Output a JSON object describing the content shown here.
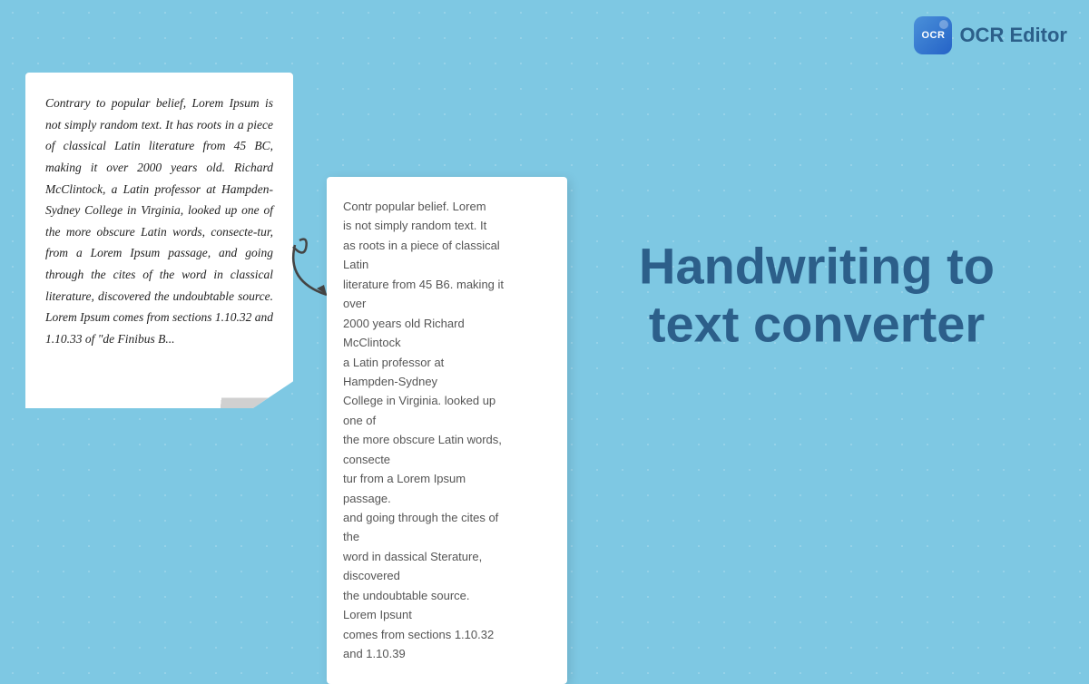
{
  "header": {
    "logo_text": "OCR",
    "title": "OCR Editor"
  },
  "handwritten": {
    "text": "Contrary to popular belief, Lorem Ipsum is not simply random text. It has roots in a piece of classical Latin literature from 45 BC, making it over 2000 years old. Richard McClintock, a Latin professor at Hampden-Sydney College in Virginia, looked up one of the more obscure Latin words, consecte-tur, from a Lorem Ipsum passage, and going through the cites of the word in classical literature, discovered the undoubtable source. Lorem Ipsum comes from sections 1.10.32 and 1.10.33 of \"de Finibus B..."
  },
  "ocr_output": {
    "lines": [
      "Contr popular belief. Lorem",
      "is not simply random text. It",
      "as roots in a piece of classical",
      "Latin",
      "literature from 45 B6. making it",
      "over",
      "2000 years old Richard",
      "McClintock",
      "a Latin professor at",
      "Hampden-Sydney",
      "College in Virginia. looked up",
      "one of",
      "the more obscure Latin words,",
      "consecte",
      "tur from a Lorem Ipsum",
      "passage.",
      "and going through the cites of",
      "the",
      "word in dassical Sterature,",
      "discovered",
      "the undoubtable source.",
      "Lorem Ipsunt",
      "comes from sections 1.10.32",
      "and 1.10.39"
    ]
  },
  "heading": {
    "line1": "Handwriting to",
    "line2": "text converter"
  },
  "colors": {
    "background": "#7ec8e3",
    "heading_color": "#2c5f8a",
    "logo_bg": "#4a90d9"
  }
}
